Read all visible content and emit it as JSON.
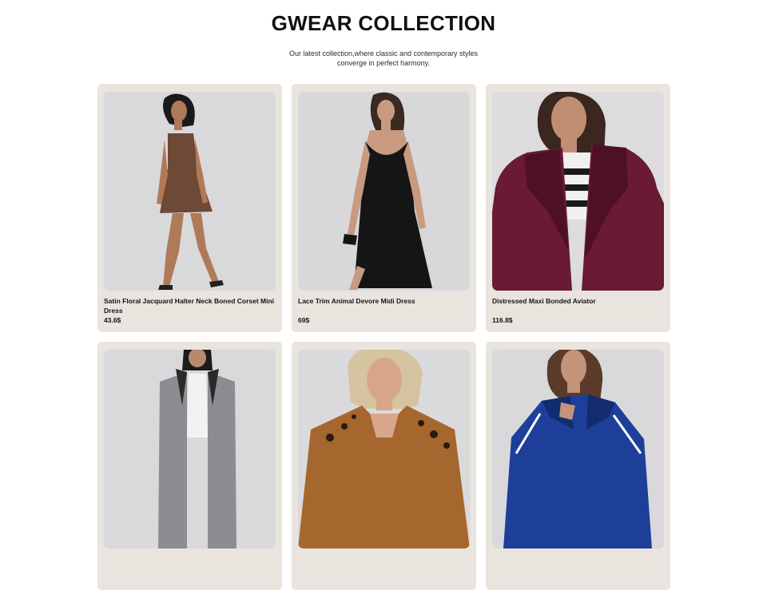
{
  "header": {
    "title": "GWEAR COLLECTION",
    "subtitle": "Our latest collection,where classic and contemporary styles converge in perfect harmony."
  },
  "products": [
    {
      "name": "Satin Floral Jacquard Halter Neck Boned Corset Mini Dress",
      "price": "43.6$"
    },
    {
      "name": "Lace Trim Animal Devore Midi Dress",
      "price": "69$"
    },
    {
      "name": "Distressed Maxi Bonded Aviator",
      "price": "116.8$"
    },
    {
      "name": "",
      "price": ""
    },
    {
      "name": "",
      "price": ""
    },
    {
      "name": "",
      "price": ""
    }
  ],
  "colors": {
    "card_bg": "#e9e4de",
    "photo_bg": "#d7d7da",
    "brown_dress": "#6e4a36",
    "black_dress": "#151515",
    "burgundy_jacket": "#6a1a33",
    "grey_coat": "#8b8d90",
    "leopard": "#a6672e",
    "blue_jacket": "#1d3f9a"
  }
}
